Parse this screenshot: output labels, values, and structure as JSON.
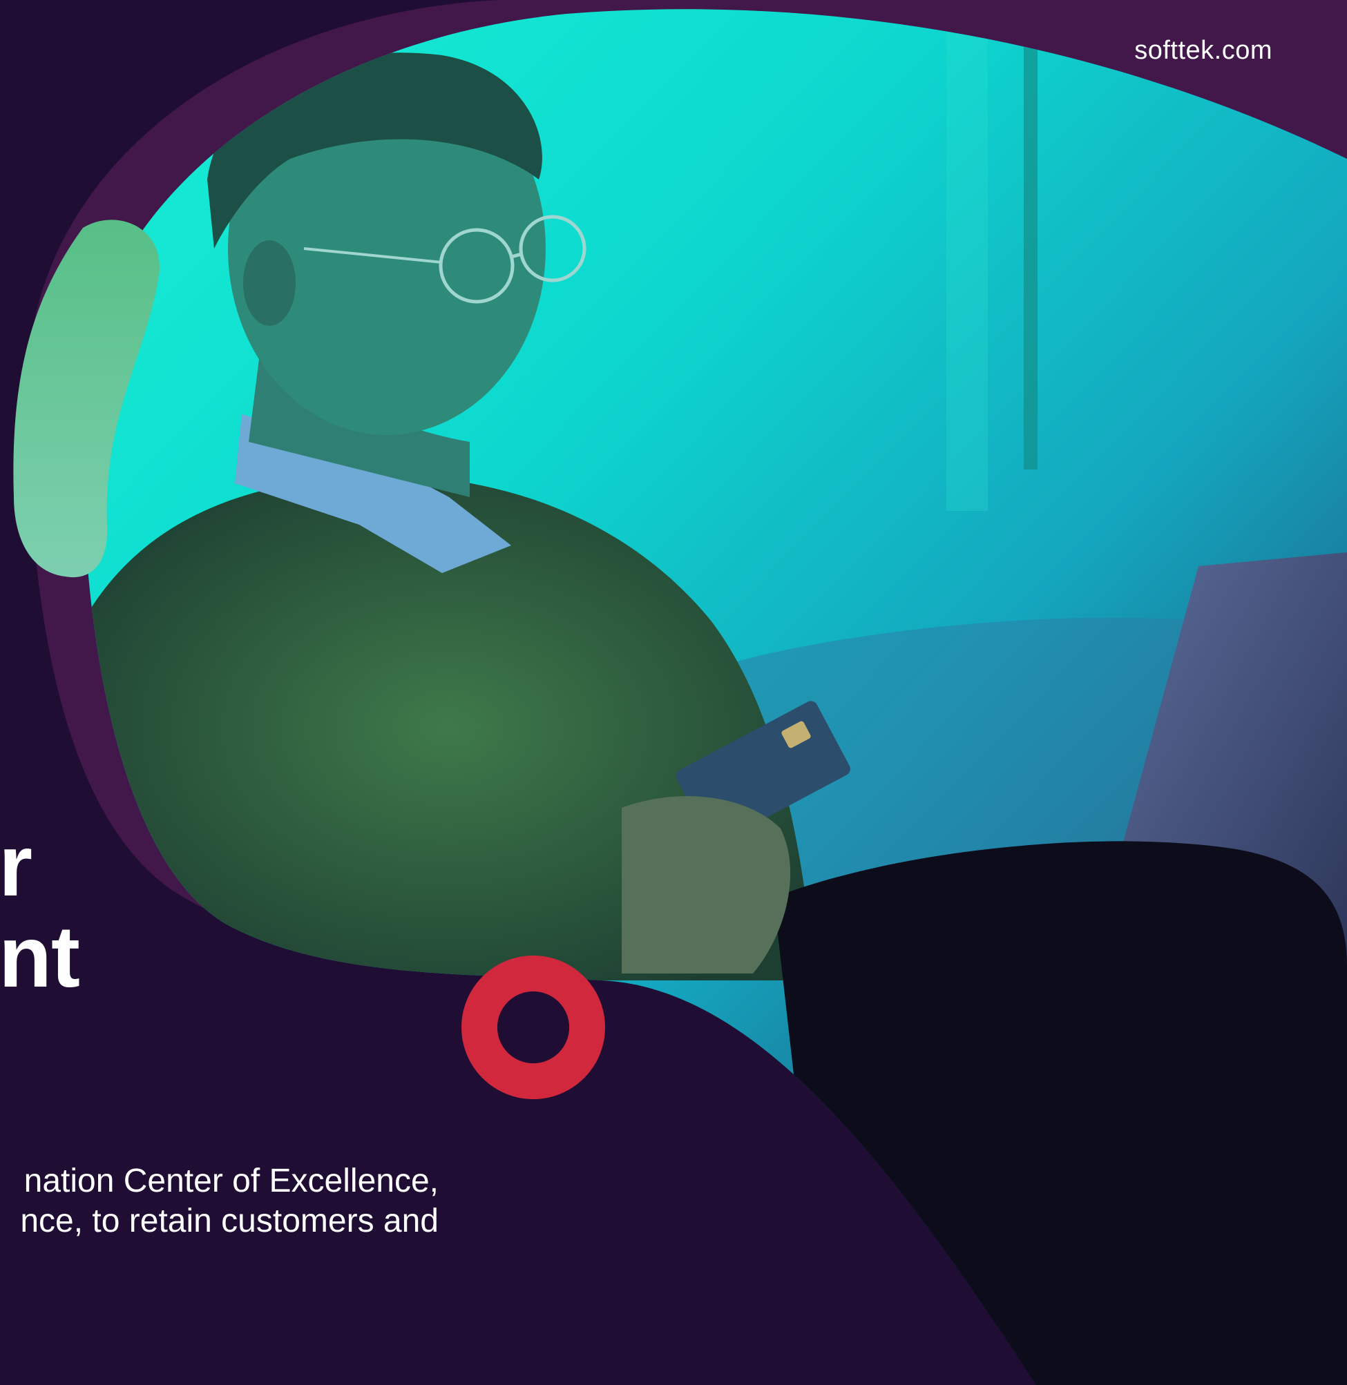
{
  "header": {
    "site_url": "softtek.com"
  },
  "hero": {
    "headline_lines": [
      "r",
      "nt"
    ],
    "body_lines": [
      "nation Center of Excellence,",
      "nce, to retain customers and"
    ],
    "photo_description_icon": "person-with-credit-card-photo"
  },
  "colors": {
    "background": "#1f0d33",
    "blob_purple": "#42174a",
    "photo_teal": "#0fe9d4",
    "accent_green": "#6ec9a0",
    "ring_red": "#d2283d"
  }
}
